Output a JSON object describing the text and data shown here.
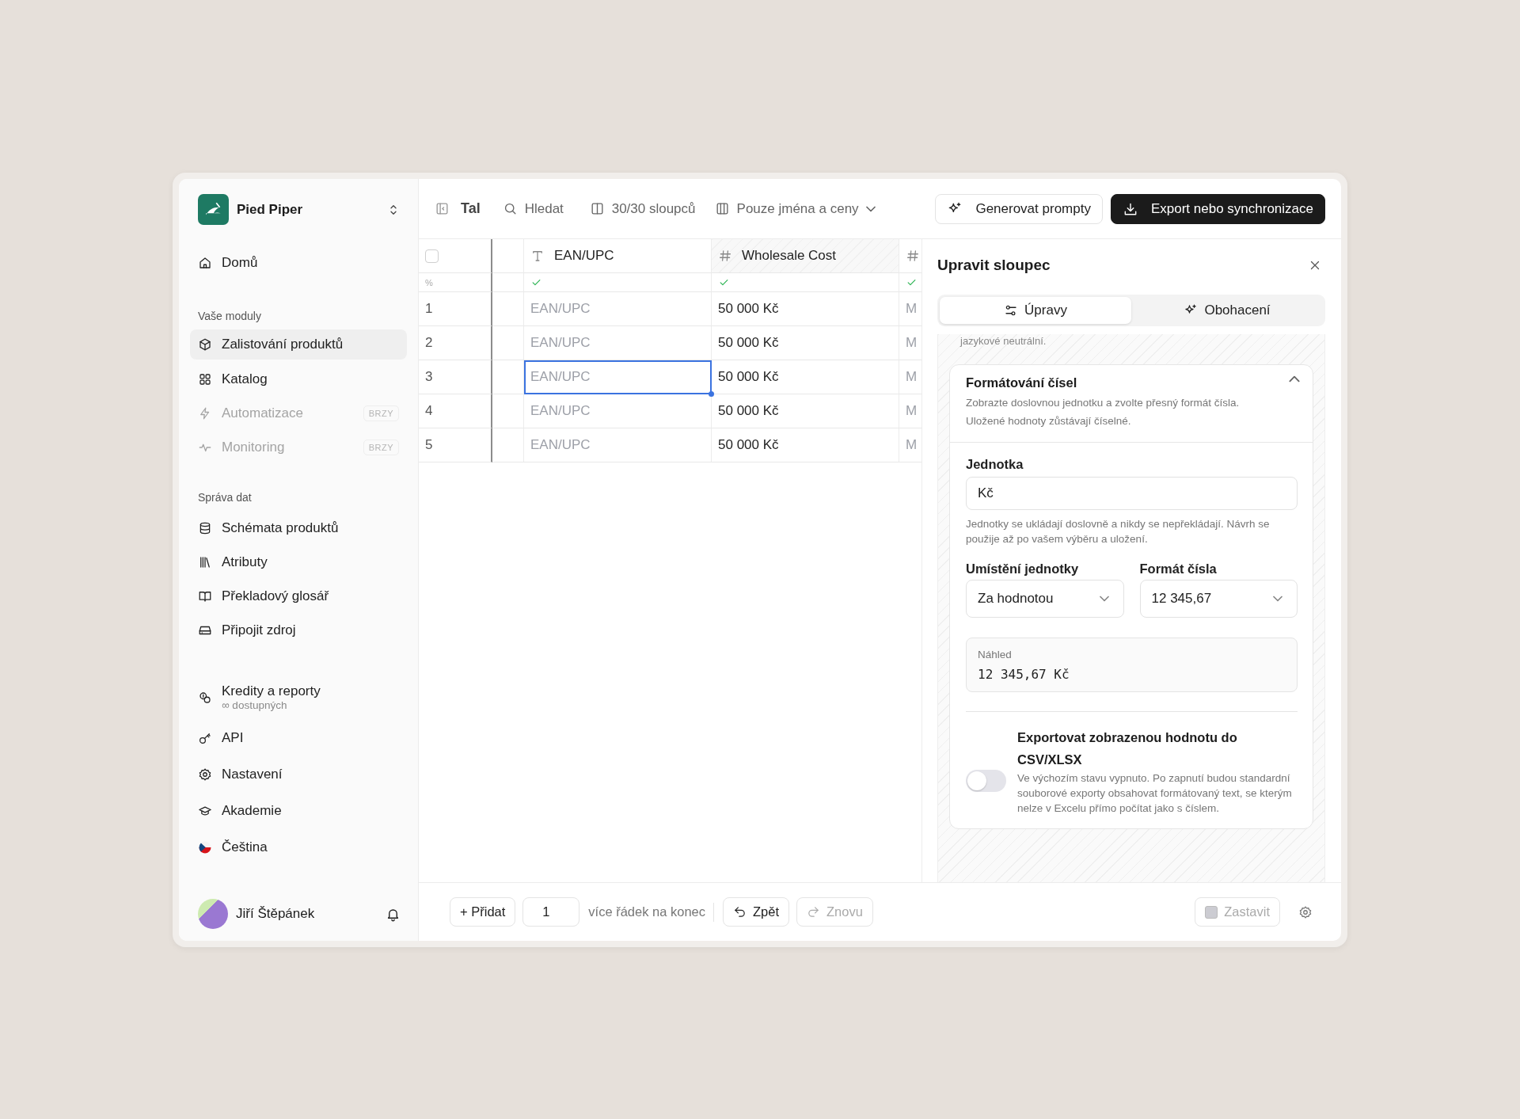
{
  "workspace": {
    "name": "Pied Piper"
  },
  "sidebar": {
    "sections": [
      {
        "items": [
          {
            "label": "Domů",
            "selected": false,
            "disabled": false
          }
        ]
      },
      {
        "heading": "Vaše moduly",
        "items": [
          {
            "label": "Zalistování produktů",
            "selected": true,
            "disabled": false
          },
          {
            "label": "Katalog",
            "selected": false,
            "disabled": false
          },
          {
            "label": "Automatizace",
            "selected": false,
            "disabled": true,
            "badge": "BRZY"
          },
          {
            "label": "Monitoring",
            "selected": false,
            "disabled": true,
            "badge": "BRZY"
          }
        ]
      },
      {
        "heading": "Správa dat",
        "items": [
          {
            "label": "Schémata produktů",
            "selected": false,
            "disabled": false
          },
          {
            "label": "Atributy",
            "selected": false,
            "disabled": false
          },
          {
            "label": "Překladový glosář",
            "selected": false,
            "disabled": false
          },
          {
            "label": "Připojit zdroj",
            "selected": false,
            "disabled": false
          }
        ]
      },
      {
        "items": [
          {
            "label": "Kredity a reporty",
            "sublabel": "∞ dostupných",
            "selected": false,
            "disabled": false
          },
          {
            "label": "API",
            "selected": false,
            "disabled": false
          },
          {
            "label": "Nastavení",
            "selected": false,
            "disabled": false
          },
          {
            "label": "Akademie",
            "selected": false,
            "disabled": false
          },
          {
            "label": "Čeština",
            "selected": false,
            "disabled": false
          }
        ]
      }
    ],
    "user": {
      "name": "Jiří Štěpánek"
    }
  },
  "toolbar": {
    "title": "Tal",
    "search": {
      "placeholder": "Hledat"
    },
    "columns_button": "30/30 sloupců",
    "view_select": "Pouze jména a ceny",
    "buttons": [
      {
        "label": "Generovat prompty",
        "kind": "secondary"
      },
      {
        "label": "Export nebo synchronizace",
        "kind": "primary"
      }
    ]
  },
  "table": {
    "select_all": {
      "checked": false
    },
    "progress_label": "%",
    "columns": [
      {
        "kind": "text",
        "label": "EAN/UPC",
        "validated": true,
        "highlighted": false
      },
      {
        "kind": "number",
        "label": "Wholesale Cost",
        "validated": true,
        "highlighted": true
      },
      {
        "kind": "number",
        "validated": true,
        "highlighted": false
      }
    ],
    "rows": [
      {
        "number": "1",
        "cells": [
          {
            "placeholder": "EAN/UPC",
            "selected": false
          },
          {
            "value": "50 000 Kč",
            "selected": false
          },
          {
            "placeholder": "M",
            "selected": false
          }
        ]
      },
      {
        "number": "2",
        "cells": [
          {
            "placeholder": "EAN/UPC",
            "selected": false
          },
          {
            "value": "50 000 Kč",
            "selected": false
          },
          {
            "placeholder": "M",
            "selected": false
          }
        ]
      },
      {
        "number": "3",
        "cells": [
          {
            "placeholder": "EAN/UPC",
            "selected": true
          },
          {
            "value": "50 000 Kč",
            "selected": false
          },
          {
            "placeholder": "M",
            "selected": false
          }
        ]
      },
      {
        "number": "4",
        "cells": [
          {
            "placeholder": "EAN/UPC",
            "selected": false
          },
          {
            "value": "50 000 Kč",
            "selected": false
          },
          {
            "placeholder": "M",
            "selected": false
          }
        ]
      },
      {
        "number": "5",
        "cells": [
          {
            "placeholder": "EAN/UPC",
            "selected": false
          },
          {
            "value": "50 000 Kč",
            "selected": false
          },
          {
            "placeholder": "M",
            "selected": false
          }
        ]
      }
    ]
  },
  "panel": {
    "title": "Upravit sloupec",
    "tabs": [
      {
        "label": "Úpravy",
        "selected": true
      },
      {
        "label": "Obohacení",
        "selected": false
      }
    ],
    "clipped_text": "jazykové neutrální.",
    "section": {
      "title": "Formátování čísel",
      "description": "Zobrazte doslovnou jednotku a zvolte přesný formát čísla. Uložené hodnoty zůstávají číselné.",
      "expanded": true,
      "unit": {
        "label": "Jednotka",
        "value": "Kč",
        "hint": "Jednotky se ukládají doslovně a nikdy se nepřekládají. Návrh se použije až po vašem výběru a uložení."
      },
      "selects": [
        {
          "label": "Umístění jednotky",
          "value": "Za hodnotou"
        },
        {
          "label": "Formát čísla",
          "value": "12 345,67"
        }
      ],
      "preview": {
        "label": "Náhled",
        "value": "12 345,67 Kč"
      },
      "export_toggle": {
        "label": "Exportovat zobrazenou hodnotu do CSV/XLSX",
        "description": "Ve výchozím stavu vypnuto. Po zapnutí budou standardní souborové exporty obsahovat formátovaný text, se kterým nelze v Excelu přímo počítat jako s číslem.",
        "on": false
      }
    }
  },
  "footer": {
    "add_button": "+ Přidat",
    "row_count": "1",
    "add_suffix": "více řádek na konec",
    "undo": {
      "label": "Zpět",
      "disabled": false
    },
    "redo": {
      "label": "Znovu",
      "disabled": true
    },
    "stop": {
      "label": "Zastavit",
      "disabled": true
    }
  }
}
